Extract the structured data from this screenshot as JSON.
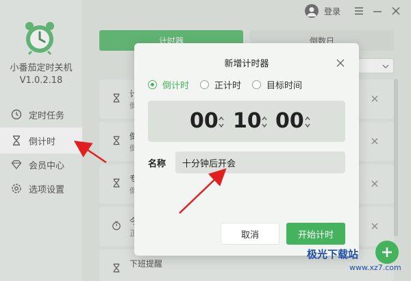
{
  "app": {
    "name": "小番茄定时关机",
    "version": "V1.0.2.18"
  },
  "topbar": {
    "login_label": "登录"
  },
  "sidebar": {
    "items": [
      {
        "label": "定时任务",
        "icon": "clock-icon",
        "active": false
      },
      {
        "label": "倒计时",
        "icon": "hourglass-icon",
        "active": true
      },
      {
        "label": "会员中心",
        "icon": "diamond-icon",
        "active": false
      },
      {
        "label": "选项设置",
        "icon": "gear-icon",
        "active": false
      }
    ]
  },
  "tabs": [
    {
      "label": "计时器",
      "active": true
    },
    {
      "label": "倒数日",
      "active": false
    }
  ],
  "background_rows": [
    {
      "name": "计",
      "sub": "倒",
      "icon": "hourglass-icon"
    },
    {
      "name": "倒",
      "sub": "倒",
      "icon": "hourglass-icon"
    },
    {
      "name": "专",
      "sub": "倒",
      "icon": "hourglass-icon"
    },
    {
      "name": "今",
      "sub": "正",
      "icon": "stopwatch-icon"
    },
    {
      "name": "下班提醒",
      "sub": "",
      "icon": "hourglass-icon"
    }
  ],
  "dialog": {
    "title": "新增计时器",
    "modes": [
      {
        "label": "倒计时",
        "checked": true
      },
      {
        "label": "正计时",
        "checked": false
      },
      {
        "label": "目标时间",
        "checked": false
      }
    ],
    "time": {
      "hours": "00",
      "minutes": "10",
      "seconds": "00"
    },
    "name_label": "名称",
    "name_value": "十分钟后开会",
    "cancel_label": "取消",
    "start_label": "开始计时"
  },
  "watermark": {
    "text": "极光下载站",
    "sub": "www.xz7.com"
  },
  "colors": {
    "accent": "#45b25d",
    "annotation_arrow": "#e02020"
  }
}
